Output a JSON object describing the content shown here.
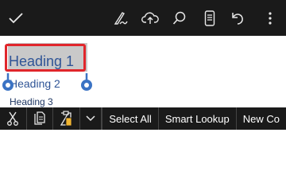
{
  "toolbar": {
    "icons": [
      "checkmark-icon",
      "draw-pen-icon",
      "cloud-upload-icon",
      "search-icon",
      "mobile-view-icon",
      "undo-icon",
      "more-options-icon"
    ]
  },
  "document": {
    "heading1": "Heading 1",
    "heading2": "Heading 2",
    "heading3": "Heading 3"
  },
  "context_menu": {
    "select_all": "Select All",
    "smart_lookup": "Smart Lookup",
    "new_comment": "New Co"
  },
  "colors": {
    "toolbar_bg": "#1a1a1a",
    "selection_outline": "#e0262b",
    "heading": "#2f5496",
    "handle": "#3b73c4"
  }
}
